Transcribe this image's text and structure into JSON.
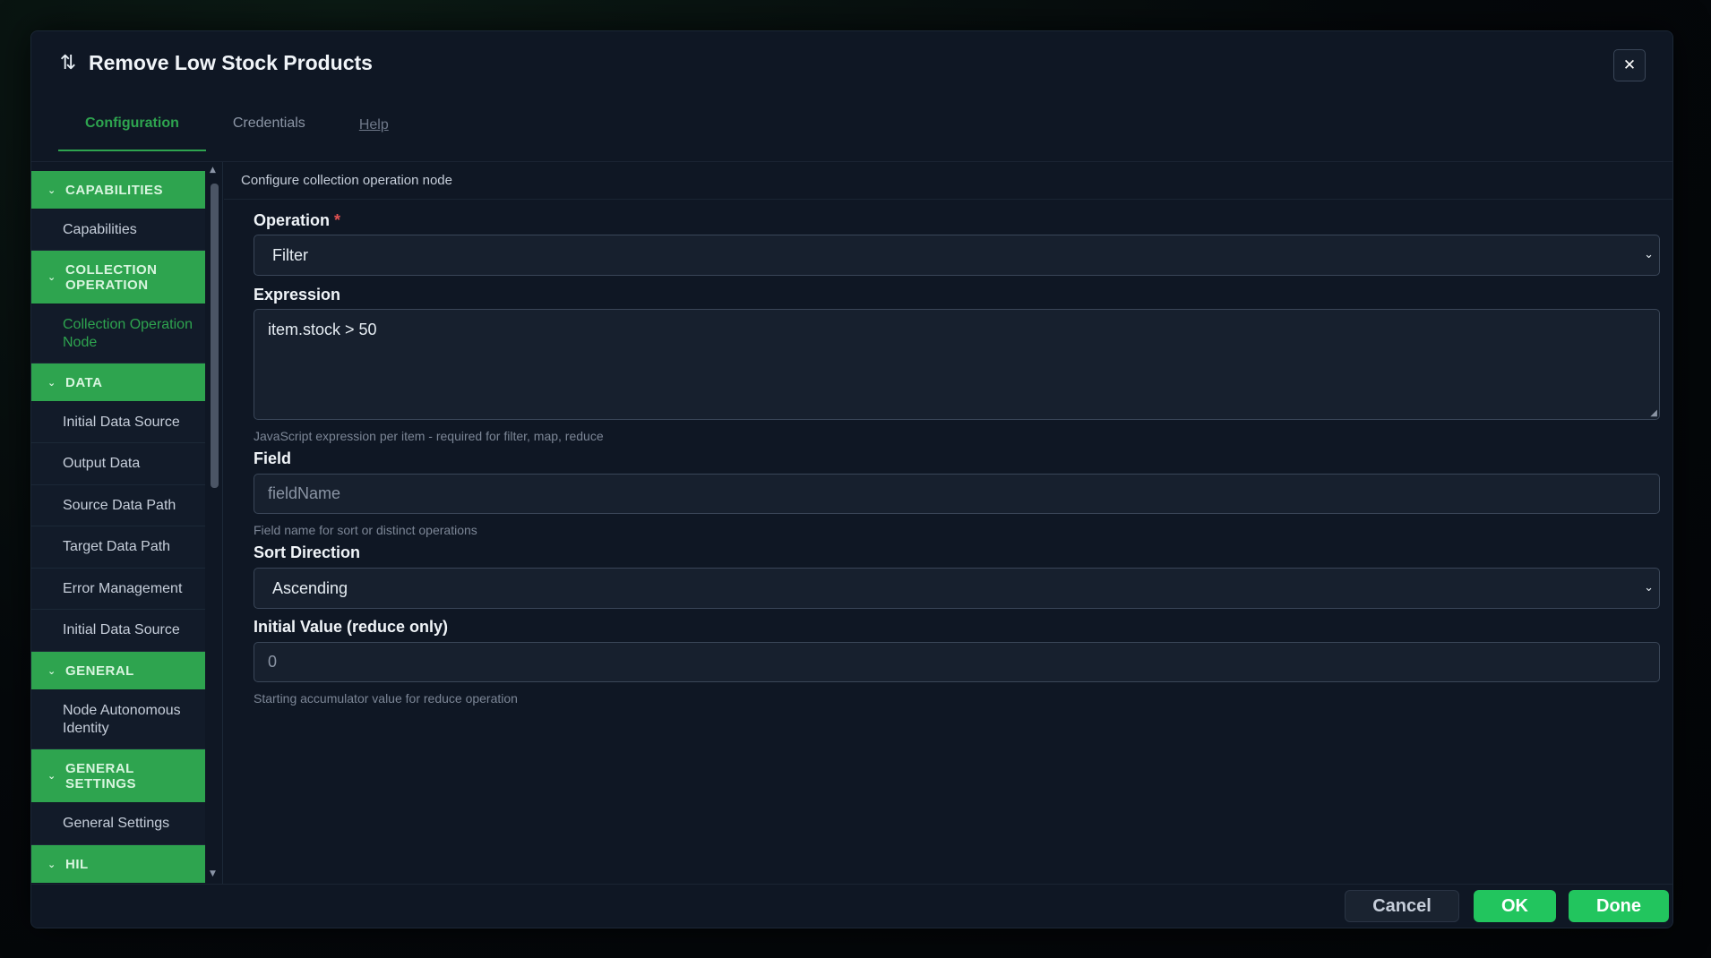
{
  "dialog": {
    "title": "Remove Low Stock Products",
    "title_icon": "⇅",
    "close_glyph": "✕"
  },
  "tabs": [
    {
      "label": "Configuration",
      "active": true
    },
    {
      "label": "Credentials",
      "active": false
    },
    {
      "label": "Help",
      "active": false
    }
  ],
  "sidebar": {
    "capabilities_head": "CAPABILITIES",
    "capabilities_item": "Capabilities",
    "collection_head": "COLLECTION OPERATION",
    "collection_item": "Collection Operation Node",
    "data_head": "DATA",
    "data_items": [
      "Initial Data Source",
      "Output Data",
      "Source Data Path",
      "Target Data Path",
      "Error Management",
      "Initial Data Source"
    ],
    "general_head": "GENERAL",
    "general_item": "Node Autonomous Identity",
    "general_settings_head": "GENERAL SETTINGS",
    "general_settings_item": "General Settings",
    "hil_head": "HIL"
  },
  "main": {
    "description": "Configure collection operation node",
    "operation": {
      "label": "Operation",
      "required_mark": "*",
      "value": "Filter"
    },
    "expression": {
      "label": "Expression",
      "value": "item.stock > 50",
      "hint": "JavaScript expression per item - required for filter, map, reduce"
    },
    "field": {
      "label": "Field",
      "placeholder": "fieldName",
      "hint": "Field name for sort or distinct operations"
    },
    "sort_direction": {
      "label": "Sort Direction",
      "value": "Ascending"
    },
    "initial_value": {
      "label": "Initial Value (reduce only)",
      "placeholder": "0",
      "hint": "Starting accumulator value for reduce operation"
    }
  },
  "footer": {
    "cancel_label": "Cancel",
    "ok_label": "OK",
    "done_label": "Done"
  },
  "colors": {
    "accent": "#2ea44f",
    "button_green": "#22c55e",
    "background": "#0f1724",
    "required": "#e05252"
  }
}
